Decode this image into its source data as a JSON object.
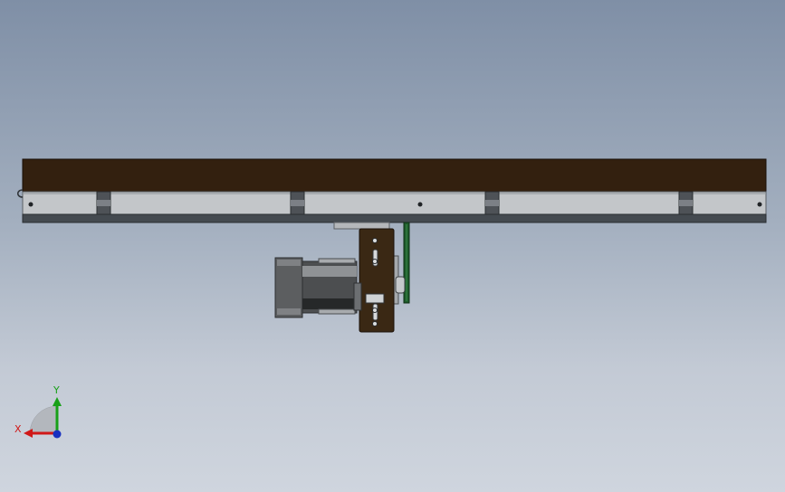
{
  "app": {
    "view": "cad-model-viewport"
  },
  "triad": {
    "x_label": "X",
    "y_label": "Y",
    "colors": {
      "x": "#d01818",
      "y": "#18a018",
      "z": "#1830c0"
    }
  },
  "colors": {
    "belt_top": "#33200f",
    "rail_side": "#c3c6c9",
    "rail_bottom": "#444a50",
    "motor_body": "#5c5e60",
    "bracket_plate": "#3a2814",
    "timing_belt": "#1d5a2a",
    "background_top": "#7f8fa6",
    "background_bottom": "#cfd5de"
  }
}
